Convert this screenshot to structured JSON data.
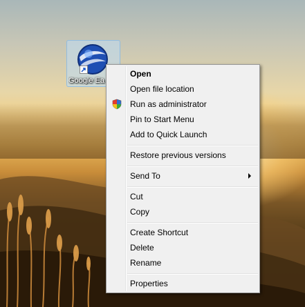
{
  "desktop": {
    "icon_label": "Google Ea"
  },
  "context_menu": {
    "items": [
      {
        "label": "Open"
      },
      {
        "label": "Open file location"
      },
      {
        "label": "Run as administrator",
        "icon": "uac-shield-icon"
      },
      {
        "label": "Pin to Start Menu"
      },
      {
        "label": "Add to Quick Launch"
      },
      {
        "label": "Restore previous versions"
      },
      {
        "label": "Send To",
        "submenu": true
      },
      {
        "label": "Cut"
      },
      {
        "label": "Copy"
      },
      {
        "label": "Create Shortcut"
      },
      {
        "label": "Delete"
      },
      {
        "label": "Rename"
      },
      {
        "label": "Properties"
      }
    ]
  },
  "colors": {
    "menu_background": "#f0f0f0",
    "menu_border": "#979797",
    "icon_selection": "#bedcf5"
  }
}
